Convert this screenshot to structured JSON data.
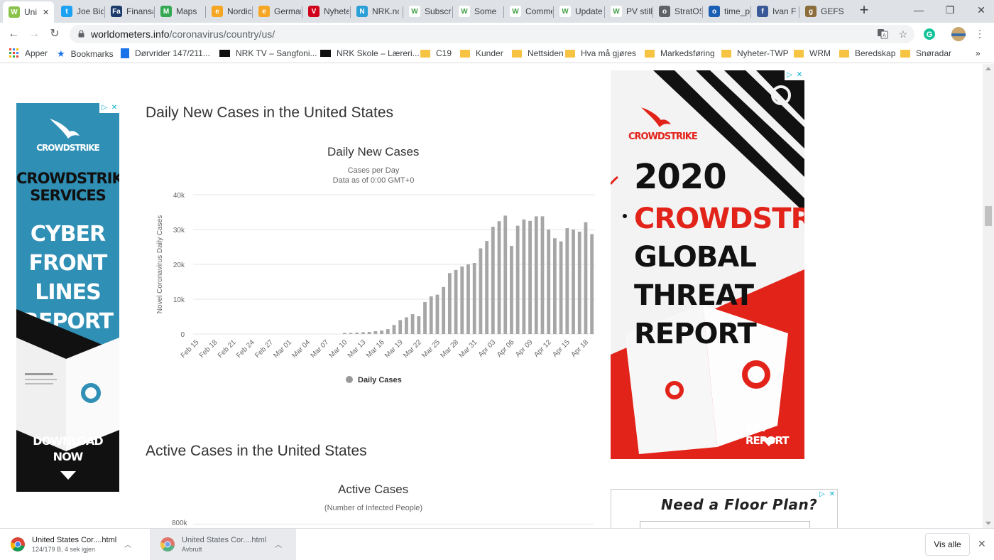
{
  "browser": {
    "tabs": [
      {
        "label": "United States Coronavirus",
        "favicon_color": "#8bc34a",
        "favicon_char": "W",
        "active": true
      },
      {
        "label": "Joe Biden",
        "favicon_color": "#1da1f2",
        "favicon_char": "t"
      },
      {
        "label": "Finansavisen",
        "favicon_color": "#1b3a6b",
        "favicon_char": "Fa"
      },
      {
        "label": "Maps",
        "favicon_color": "#34a853",
        "favicon_char": "M"
      },
      {
        "label": "Nordic",
        "favicon_color": "#f5a623",
        "favicon_char": "e"
      },
      {
        "label": "Germany",
        "favicon_color": "#f5a623",
        "favicon_char": "e"
      },
      {
        "label": "Nyheter",
        "favicon_color": "#d0021b",
        "favicon_char": "V"
      },
      {
        "label": "NRK.no",
        "favicon_color": "#2b9fd8",
        "favicon_char": "N"
      },
      {
        "label": "Subscribe",
        "favicon_color": "#ffffff",
        "favicon_char": "W"
      },
      {
        "label": "Some",
        "favicon_color": "#ffffff",
        "favicon_char": "W"
      },
      {
        "label": "Comments",
        "favicon_color": "#ffffff",
        "favicon_char": "W"
      },
      {
        "label": "Update",
        "favicon_color": "#ffffff",
        "favicon_char": "W"
      },
      {
        "label": "PV still",
        "favicon_color": "#ffffff",
        "favicon_char": "W"
      },
      {
        "label": "StratOS",
        "favicon_color": "#5f6368",
        "favicon_char": "o"
      },
      {
        "label": "time_p",
        "favicon_color": "#1a5fb4",
        "favicon_char": "o"
      },
      {
        "label": "Ivan F",
        "favicon_color": "#3b5998",
        "favicon_char": "f"
      },
      {
        "label": "GEFS",
        "favicon_color": "#8a6d3b",
        "favicon_char": "g"
      }
    ],
    "new_tab": "+",
    "window_controls": [
      "—",
      "❐",
      "✕"
    ],
    "url_host": "worldometers.info",
    "url_path": "/coronavirus/country/us/",
    "profile_initial": "G"
  },
  "bookmarks": [
    {
      "label": "Apper",
      "kind": "apps"
    },
    {
      "label": "Bookmarks",
      "kind": "star"
    },
    {
      "label": "Dørvrider 147/211...",
      "kind": "site"
    },
    {
      "label": "NRK TV – Sangfoni...",
      "kind": "nrk"
    },
    {
      "label": "NRK Skole – Læreri...",
      "kind": "nrk"
    },
    {
      "label": "C19",
      "kind": "folder"
    },
    {
      "label": "Kunder",
      "kind": "folder"
    },
    {
      "label": "Nettsiden",
      "kind": "folder"
    },
    {
      "label": "Hva må gjøres",
      "kind": "folder"
    },
    {
      "label": "Markedsføring",
      "kind": "folder"
    },
    {
      "label": "Nyheter-TWP",
      "kind": "folder"
    },
    {
      "label": "WRM",
      "kind": "folder"
    },
    {
      "label": "Beredskap",
      "kind": "folder"
    },
    {
      "label": "Snøradar",
      "kind": "folder"
    }
  ],
  "bookmarks_overflow": "»",
  "page": {
    "section1_title": "Daily New Cases in the United States",
    "section2_title": "Active Cases in the United States",
    "chart2_title": "Active Cases",
    "chart2_subtitle": "(Number of Infected People)",
    "chart2_first_tick": "800k"
  },
  "chart_data": {
    "type": "bar",
    "title": "Daily New Cases",
    "subtitle": "Cases per Day",
    "subtitle2": "Data as of 0:00 GMT+0",
    "ylabel": "Novel Coronavirus Daily Cases",
    "xlabel": "",
    "ylim": [
      0,
      40000
    ],
    "yticks": [
      "0",
      "10k",
      "20k",
      "30k",
      "40k"
    ],
    "xtick_labels": [
      "Feb 15",
      "Feb 18",
      "Feb 21",
      "Feb 24",
      "Feb 27",
      "Mar 01",
      "Mar 04",
      "Mar 07",
      "Mar 10",
      "Mar 13",
      "Mar 16",
      "Mar 19",
      "Mar 22",
      "Mar 25",
      "Mar 28",
      "Mar 31",
      "Apr 03",
      "Apr 06",
      "Apr 09",
      "Apr 12",
      "Apr 15",
      "Apr 18"
    ],
    "legend": "Daily Cases",
    "legend_position": "bottom",
    "bar_color": "#a6a6a6",
    "categories": [
      "Feb 15",
      "Feb 16",
      "Feb 17",
      "Feb 18",
      "Feb 19",
      "Feb 20",
      "Feb 21",
      "Feb 22",
      "Feb 23",
      "Feb 24",
      "Feb 25",
      "Feb 26",
      "Feb 27",
      "Feb 28",
      "Feb 29",
      "Mar 01",
      "Mar 02",
      "Mar 03",
      "Mar 04",
      "Mar 05",
      "Mar 06",
      "Mar 07",
      "Mar 08",
      "Mar 09",
      "Mar 10",
      "Mar 11",
      "Mar 12",
      "Mar 13",
      "Mar 14",
      "Mar 15",
      "Mar 16",
      "Mar 17",
      "Mar 18",
      "Mar 19",
      "Mar 20",
      "Mar 21",
      "Mar 22",
      "Mar 23",
      "Mar 24",
      "Mar 25",
      "Mar 26",
      "Mar 27",
      "Mar 28",
      "Mar 29",
      "Mar 30",
      "Mar 31",
      "Apr 01",
      "Apr 02",
      "Apr 03",
      "Apr 04",
      "Apr 05",
      "Apr 06",
      "Apr 07",
      "Apr 08",
      "Apr 09",
      "Apr 10",
      "Apr 11",
      "Apr 12",
      "Apr 13",
      "Apr 14",
      "Apr 15",
      "Apr 16",
      "Apr 17",
      "Apr 18",
      "Apr 19"
    ],
    "values": [
      0,
      0,
      0,
      0,
      0,
      0,
      0,
      0,
      0,
      0,
      0,
      0,
      0,
      0,
      0,
      0,
      0,
      0,
      0,
      0,
      0,
      0,
      0,
      0,
      300,
      300,
      400,
      500,
      600,
      800,
      1000,
      1400,
      2600,
      4000,
      4800,
      5700,
      5100,
      9200,
      10800,
      11300,
      13500,
      17500,
      18400,
      19400,
      20000,
      20400,
      24600,
      26700,
      30800,
      32400,
      34000,
      25300,
      31100,
      32900,
      32500,
      33800,
      33800,
      30000,
      27500,
      26600,
      30400,
      30000,
      29400,
      32100,
      28700
    ]
  },
  "ads": {
    "left": {
      "brand": "CROWDSTRIKE",
      "line1": "CROWDSTRIKE",
      "line2": "SERVICES",
      "line3": "CYBER",
      "line4": "FRONT LINES",
      "line5": "REPORT",
      "cta1": "DOWNLOAD",
      "cta2": "NOW"
    },
    "right": {
      "brand": "CROWDSTRIKE",
      "year": "2020",
      "line1": "CROWDSTRIKE",
      "line2": "GLOBAL THREAT",
      "line3": "REPORT",
      "cta": "GET REPORT"
    },
    "right2": {
      "text": "Need a Floor Plan?"
    }
  },
  "downloads": [
    {
      "name": "United States Cor....html",
      "status": "124/179 B, 4 sek igjen"
    },
    {
      "name": "United States Cor....html",
      "status": "Avbrutt"
    }
  ],
  "downloads_show_all": "Vis alle"
}
